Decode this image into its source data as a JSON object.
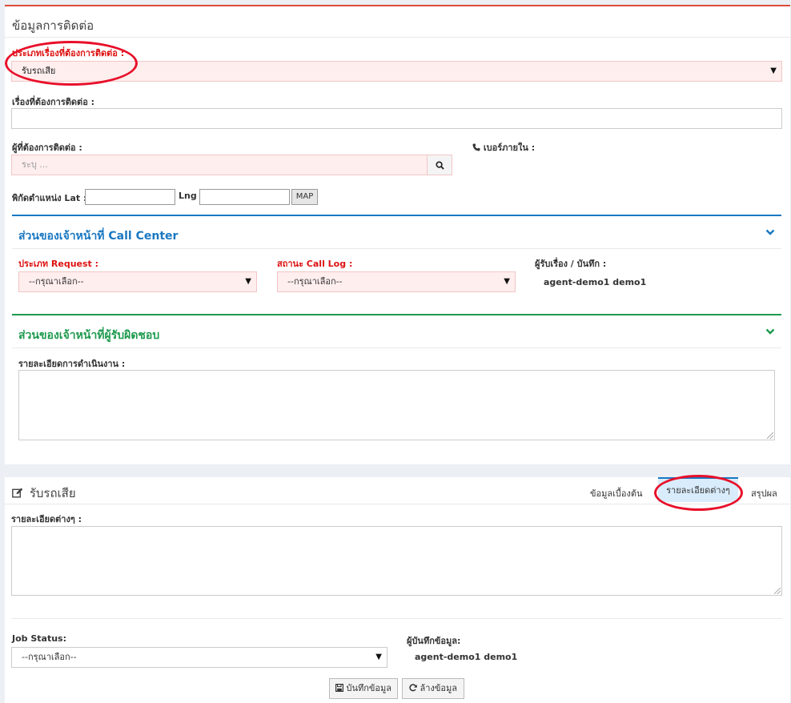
{
  "contact_section": {
    "title": "ข้อมูลการติดต่อ",
    "topic_type_label": "ประเภทเรื่องที่ต้องการติดต่อ :",
    "topic_type_value": "รับรถเสีย",
    "subject_label": "เรื่องที่ต้องการติดต่อ :",
    "subject_value": "",
    "contact_person_label": "ผู้ที่ต้องการติดต่อ :",
    "contact_person_placeholder": "ระบุ ...",
    "extension_label": "เบอร์ภายใน :",
    "coords_label": "พิกัดตำแหน่ง Lat :",
    "lat_value": "",
    "lng_label": "Lng :",
    "lng_value": "",
    "map_button": "MAP"
  },
  "call_center_panel": {
    "title": "ส่วนของเจ้าหน้าที่ Call Center",
    "request_type_label": "ประเภท Request :",
    "request_type_value": "--กรุณาเลือก--",
    "call_log_label": "สถานะ Call Log :",
    "call_log_value": "--กรุณาเลือก--",
    "receiver_label": "ผู้รับเรื่อง / บันทึก :",
    "receiver_value": "agent-demo1 demo1",
    "color": "#1a78c2"
  },
  "responsible_panel": {
    "title": "ส่วนของเจ้าหน้าที่ผู้รับผิดชอบ",
    "details_label": "รายละเอียดการดำเนินงาน :",
    "color": "#1f9a4f"
  },
  "case_section": {
    "title": "รับรถเสีย",
    "tabs": [
      "ข้อมูลเบื้องต้น",
      "รายละเอียดต่างๆ",
      "สรุปผล"
    ],
    "active_tab": 1,
    "details_label": "รายละเอียดต่างๆ :",
    "job_status_label": "Job Status:",
    "job_status_value": "--กรุณาเลือก--",
    "recorder_label": "ผู้บันทึกข้อมูล:",
    "recorder_value": "agent-demo1 demo1",
    "save_button": "บันทึกข้อมูล",
    "clear_button": "ล้างข้อมูล"
  },
  "icons": {
    "phone": "phone-icon",
    "search": "search-icon",
    "edit": "edit-icon",
    "save": "floppy-icon",
    "refresh": "refresh-icon",
    "chevron": "chevron-down-icon"
  },
  "colors": {
    "required_text": "#dd1111",
    "box_top_border": "#dd4b39",
    "annotation_circle": "#e8102a",
    "active_tab_bg": "#d9ecfb"
  }
}
